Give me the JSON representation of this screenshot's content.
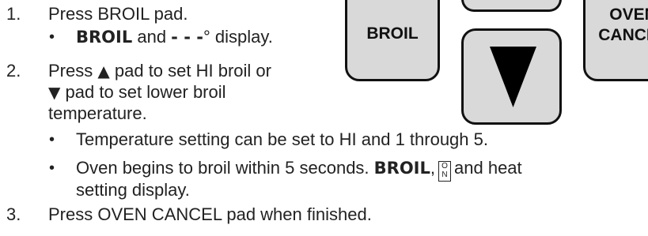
{
  "steps": [
    {
      "number": "1.",
      "lines": [
        "Press BROIL pad."
      ]
    },
    {
      "number": "2.",
      "lines": [
        "pad to set HI broil or",
        "pad to set lower broil",
        "temperature."
      ]
    },
    {
      "number": "3.",
      "lines": [
        "Press OVEN CANCEL pad when finished."
      ]
    }
  ],
  "step1_bullet": {
    "word": "BROIL",
    "middle": " and ",
    "dashes": "- - -",
    "tail": "° display."
  },
  "step2": {
    "press": "Press "
  },
  "bullets_step2": [
    {
      "text": "Temperature setting can be set to HI and 1 through 5."
    },
    {
      "prefix": "Oven begins to broil within 5 seconds. ",
      "word": "BROIL",
      "comma": ",",
      "tail": "and heat",
      "continuation": "setting display."
    }
  ],
  "on_icon": {
    "top": "O",
    "bottom": "N"
  },
  "icons": {
    "up": "up-triangle-icon",
    "down": "down-triangle-icon"
  },
  "keypad": {
    "broil_label": "BROIL",
    "cancel_label_line1": "OVEN",
    "cancel_label_line2": "CANCEL"
  }
}
